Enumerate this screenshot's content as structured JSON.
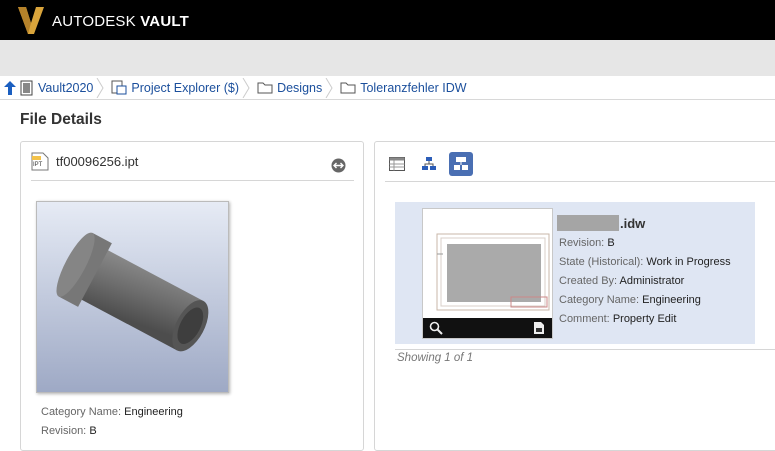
{
  "app": {
    "brand_prefix": "AUTODESK",
    "brand_product": "VAULT",
    "colors": {
      "brand_gold": "#d9a43b",
      "link_blue": "#1b4f9c",
      "active_tab": "#4a6fb3"
    }
  },
  "breadcrumb": [
    {
      "label": "Vault2020",
      "icon": "vault-icon"
    },
    {
      "label": "Project Explorer ($)",
      "icon": "project-explorer-icon"
    },
    {
      "label": "Designs",
      "icon": "folder-icon"
    },
    {
      "label": "Toleranzfehler IDW",
      "icon": "folder-icon"
    }
  ],
  "page": {
    "title": "File Details"
  },
  "file": {
    "name": "tf00096256.ipt",
    "type_badge": "IPT",
    "properties": [
      {
        "label": "Category Name:",
        "value": "Engineering"
      },
      {
        "label": "Revision:",
        "value": "B"
      }
    ]
  },
  "related": {
    "title_suffix": ".idw",
    "properties": [
      {
        "label": "Revision:",
        "value": "B"
      },
      {
        "label": "State (Historical):",
        "value": "Work in Progress"
      },
      {
        "label": "Created By:",
        "value": "Administrator"
      },
      {
        "label": "Category Name:",
        "value": "Engineering"
      },
      {
        "label": "Comment:",
        "value": "Property Edit"
      }
    ],
    "showing": "Showing 1 of 1"
  }
}
